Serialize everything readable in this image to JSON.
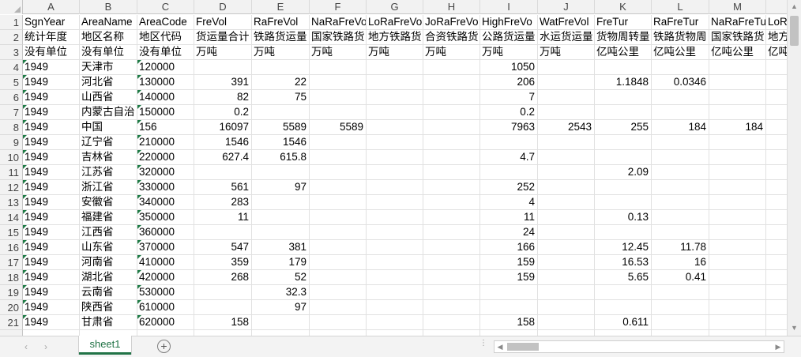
{
  "columns": [
    "A",
    "B",
    "C",
    "D",
    "E",
    "F",
    "G",
    "H",
    "I",
    "J",
    "K",
    "L",
    "M",
    ""
  ],
  "rows": [
    {
      "n": "1",
      "cells": [
        "SgnYear",
        "AreaName",
        "AreaCode",
        "FreVol",
        "RaFreVol",
        "NaRaFreVo",
        "LoRaFreVo",
        "JoRaFreVo",
        "HighFreVo",
        "WatFreVol",
        "FreTur",
        "RaFreTur",
        "NaRaFreTu",
        "LoR"
      ]
    },
    {
      "n": "2",
      "cells": [
        "统计年度",
        "地区名称",
        "地区代码",
        "货运量合计",
        "铁路货运量",
        "国家铁路货",
        "地方铁路货",
        "合资铁路货",
        "公路货运量",
        "水运货运量",
        "货物周转量",
        "铁路货物周",
        "国家铁路货",
        "地方"
      ]
    },
    {
      "n": "3",
      "cells": [
        "没有单位",
        "没有单位",
        "没有单位",
        "万吨",
        "万吨",
        "万吨",
        "万吨",
        "万吨",
        "万吨",
        "万吨",
        "亿吨公里",
        "亿吨公里",
        "亿吨公里",
        "亿吨"
      ]
    },
    {
      "n": "4",
      "cells": [
        "1949",
        "天津市",
        "120000",
        "",
        "",
        "",
        "",
        "",
        "1050",
        "",
        "",
        "",
        "",
        ""
      ]
    },
    {
      "n": "5",
      "cells": [
        "1949",
        "河北省",
        "130000",
        "391",
        "22",
        "",
        "",
        "",
        "206",
        "",
        "1.1848",
        "0.0346",
        "",
        ""
      ]
    },
    {
      "n": "6",
      "cells": [
        "1949",
        "山西省",
        "140000",
        "82",
        "75",
        "",
        "",
        "",
        "7",
        "",
        "",
        "",
        "",
        ""
      ]
    },
    {
      "n": "7",
      "cells": [
        "1949",
        "内蒙古自治",
        "150000",
        "0.2",
        "",
        "",
        "",
        "",
        "0.2",
        "",
        "",
        "",
        "",
        ""
      ]
    },
    {
      "n": "8",
      "cells": [
        "1949",
        "中国",
        "156",
        "16097",
        "5589",
        "5589",
        "",
        "",
        "7963",
        "2543",
        "255",
        "184",
        "184",
        ""
      ]
    },
    {
      "n": "9",
      "cells": [
        "1949",
        "辽宁省",
        "210000",
        "1546",
        "1546",
        "",
        "",
        "",
        "",
        "",
        "",
        "",
        "",
        ""
      ]
    },
    {
      "n": "10",
      "cells": [
        "1949",
        "吉林省",
        "220000",
        "627.4",
        "615.8",
        "",
        "",
        "",
        "4.7",
        "",
        "",
        "",
        "",
        ""
      ]
    },
    {
      "n": "11",
      "cells": [
        "1949",
        "江苏省",
        "320000",
        "",
        "",
        "",
        "",
        "",
        "",
        "",
        "2.09",
        "",
        "",
        ""
      ]
    },
    {
      "n": "12",
      "cells": [
        "1949",
        "浙江省",
        "330000",
        "561",
        "97",
        "",
        "",
        "",
        "252",
        "",
        "",
        "",
        "",
        ""
      ]
    },
    {
      "n": "13",
      "cells": [
        "1949",
        "安徽省",
        "340000",
        "283",
        "",
        "",
        "",
        "",
        "4",
        "",
        "",
        "",
        "",
        ""
      ]
    },
    {
      "n": "14",
      "cells": [
        "1949",
        "福建省",
        "350000",
        "11",
        "",
        "",
        "",
        "",
        "11",
        "",
        "0.13",
        "",
        "",
        ""
      ]
    },
    {
      "n": "15",
      "cells": [
        "1949",
        "江西省",
        "360000",
        "",
        "",
        "",
        "",
        "",
        "24",
        "",
        "",
        "",
        "",
        ""
      ]
    },
    {
      "n": "16",
      "cells": [
        "1949",
        "山东省",
        "370000",
        "547",
        "381",
        "",
        "",
        "",
        "166",
        "",
        "12.45",
        "11.78",
        "",
        ""
      ]
    },
    {
      "n": "17",
      "cells": [
        "1949",
        "河南省",
        "410000",
        "359",
        "179",
        "",
        "",
        "",
        "159",
        "",
        "16.53",
        "16",
        "",
        ""
      ]
    },
    {
      "n": "18",
      "cells": [
        "1949",
        "湖北省",
        "420000",
        "268",
        "52",
        "",
        "",
        "",
        "159",
        "",
        "5.65",
        "0.41",
        "",
        ""
      ]
    },
    {
      "n": "19",
      "cells": [
        "1949",
        "云南省",
        "530000",
        "",
        "32.3",
        "",
        "",
        "",
        "",
        "",
        "",
        "",
        "",
        ""
      ]
    },
    {
      "n": "20",
      "cells": [
        "1949",
        "陕西省",
        "610000",
        "",
        "97",
        "",
        "",
        "",
        "",
        "",
        "",
        "",
        "",
        ""
      ]
    },
    {
      "n": "21",
      "cells": [
        "1949",
        "甘肃省",
        "620000",
        "158",
        "",
        "",
        "",
        "",
        "158",
        "",
        "0.611",
        "",
        "",
        ""
      ]
    }
  ],
  "sheet_tab": "sheet1",
  "icons": {
    "scroll_up": "▲",
    "scroll_down": "▼",
    "scroll_left": "◀",
    "scroll_right": "▶",
    "nav_prev": "‹",
    "nav_next": "›",
    "add_sheet": "+",
    "splitter": "⋮"
  },
  "colors": {
    "accent": "#217346",
    "error_indicator": "#1e7b45"
  }
}
